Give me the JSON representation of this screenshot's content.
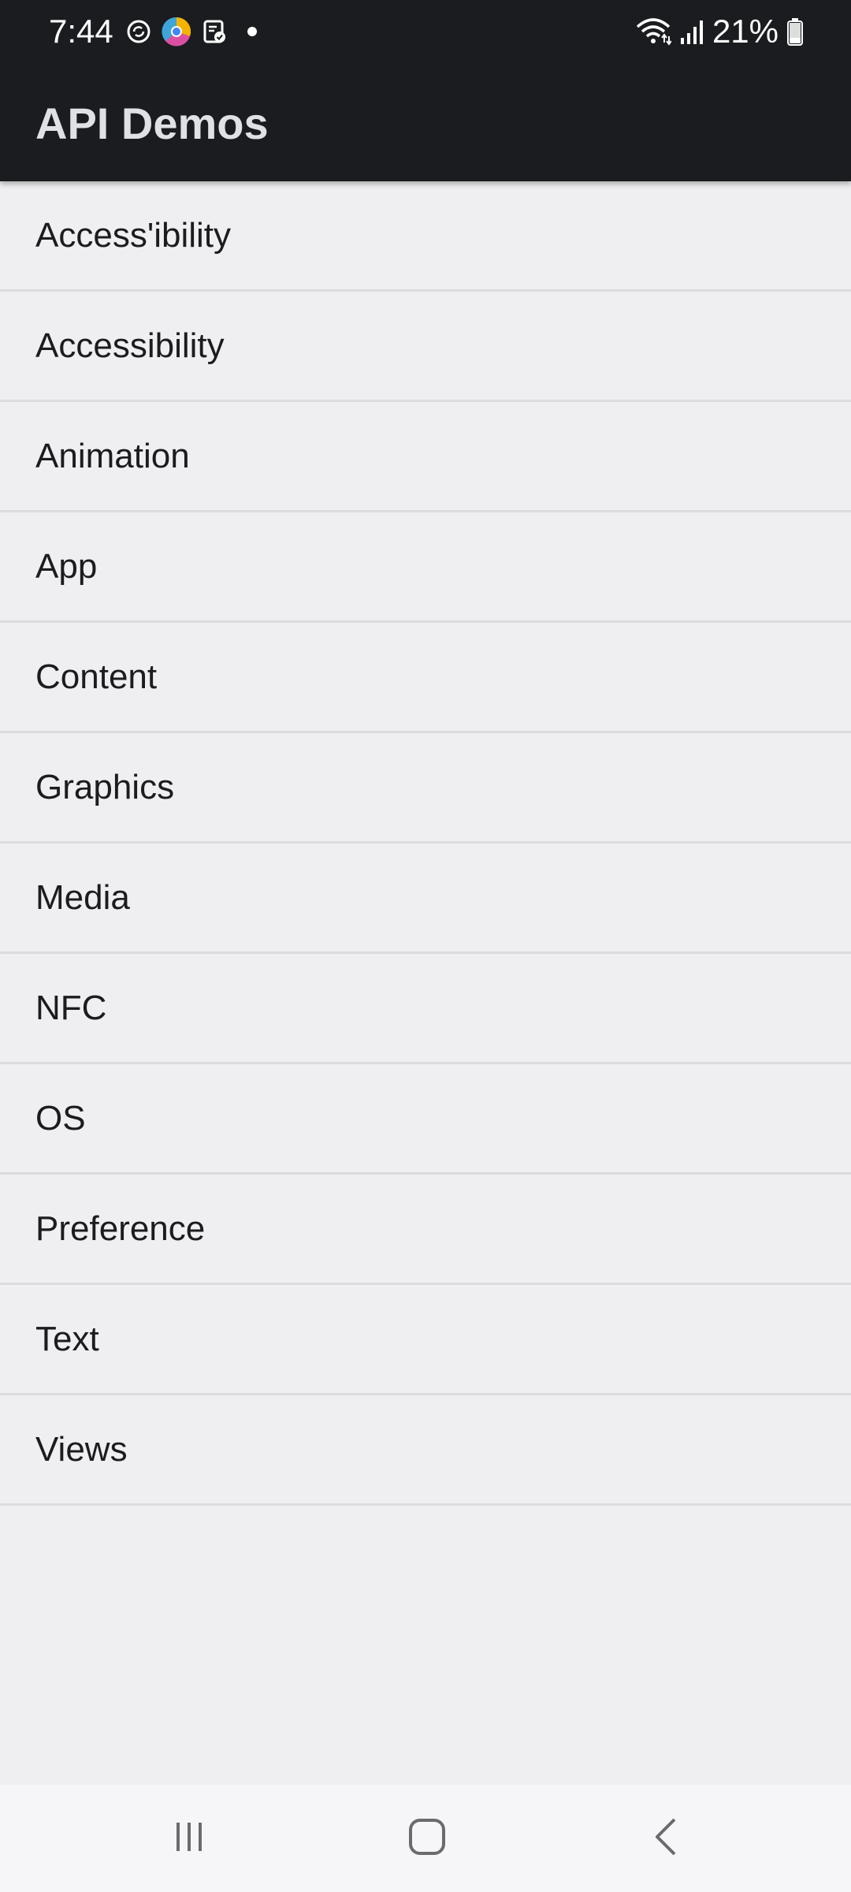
{
  "status_bar": {
    "time": "7:44",
    "battery_percent": "21%",
    "icons": [
      "sync-icon",
      "chrome-icon",
      "clipboard-check-icon",
      "notification-dot-icon",
      "wifi-icon",
      "signal-icon",
      "battery-icon"
    ]
  },
  "app_bar": {
    "title": "API Demos"
  },
  "list": {
    "items": [
      {
        "label": "Access'ibility"
      },
      {
        "label": "Accessibility"
      },
      {
        "label": "Animation"
      },
      {
        "label": "App"
      },
      {
        "label": "Content"
      },
      {
        "label": "Graphics"
      },
      {
        "label": "Media"
      },
      {
        "label": "NFC"
      },
      {
        "label": "OS"
      },
      {
        "label": "Preference"
      },
      {
        "label": "Text"
      },
      {
        "label": "Views"
      }
    ]
  },
  "nav_bar": {
    "buttons": [
      "recents-icon",
      "home-icon",
      "back-icon"
    ]
  },
  "colors": {
    "app_bar_bg": "#1a1c1f",
    "list_bg": "#efeff1",
    "divider": "#dcdcde",
    "title_text": "#dfe1e4"
  }
}
